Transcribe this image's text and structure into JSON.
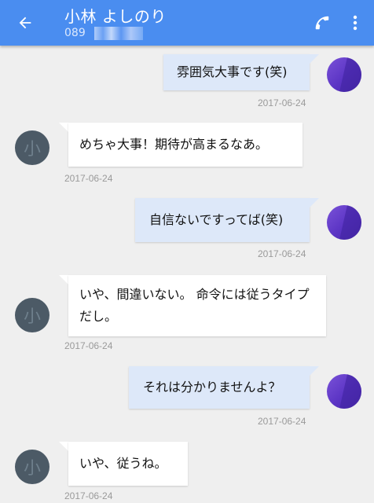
{
  "header": {
    "contact_name": "小林 よしのり",
    "phone_visible": "089",
    "back_icon": "arrow-left-icon",
    "call_icon": "phone-icon",
    "menu_icon": "more-vert-icon"
  },
  "colors": {
    "appbar": "#4a8df0",
    "outgoing_bubble": "#dde8f9",
    "incoming_bubble": "#ffffff",
    "background": "#efefef",
    "my_avatar": "#5b34c4",
    "their_avatar": "#4c5a66"
  },
  "messages": [
    {
      "direction": "out",
      "text": "雰囲気大事です(笑)",
      "date": "2017-06-24"
    },
    {
      "direction": "in",
      "text": "めちゃ大事！期待が高まるなあ。",
      "date": "2017-06-24"
    },
    {
      "direction": "out",
      "text": "自信ないですってば(笑)",
      "date": "2017-06-24"
    },
    {
      "direction": "in",
      "text": "いや、間違いない。 命令には従うタイプだし。",
      "date": "2017-06-24"
    },
    {
      "direction": "out",
      "text": "それは分かりませんよ？",
      "date": "2017-06-24"
    },
    {
      "direction": "in",
      "text": "いや、従うね。",
      "date": "2017-06-24"
    }
  ]
}
